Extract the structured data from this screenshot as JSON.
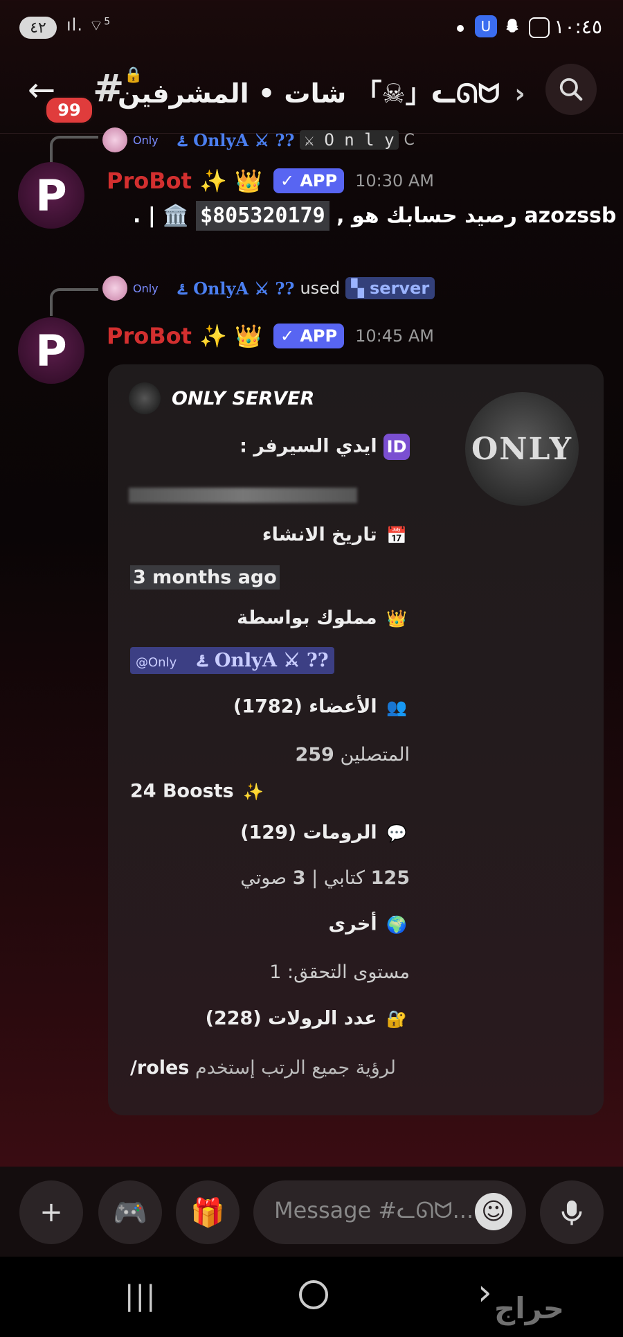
{
  "status_bar": {
    "battery": "٤٢",
    "signal": "ıl.",
    "wifi_label": "5",
    "clock": "١٠:٤٥"
  },
  "header": {
    "unread_badge": "99",
    "channel_name": "شات • المشرفين 「☠」ᓚᘏᗢ",
    "chevron": "›"
  },
  "messages": [
    {
      "reply_tag": "Only",
      "reply_user": "ۓ OnlyA ⚔ ??",
      "reply_extra": "⚔ O n l y",
      "reply_trailing": "C",
      "bot_name": "ProBot ✨ 👑",
      "app_badge": "✓ APP",
      "time": "10:30 AM",
      "body_name": "azozssb ـ",
      "body_text": ", رصيد حسابك هو",
      "body_amount": "$805320179",
      "body_tail": ". | 🏛️"
    },
    {
      "reply_tag": "Only",
      "reply_user": "ۓ OnlyA ⚔ ??",
      "reply_used": "used",
      "reply_command": "server",
      "bot_name": "ProBot ✨ 👑",
      "app_badge": "✓ APP",
      "time": "10:45 AM"
    }
  ],
  "embed": {
    "title": "ONLY SERVER",
    "thumbnail_text": "ONLY",
    "server_id_label": ": ايدي السيرفر",
    "server_id_icon": "ID",
    "created_label": "تاريخ الانشاء",
    "created_icon": "📅",
    "created_value": "3 months ago",
    "owner_label": "مملوك بواسطة",
    "owner_icon": "👑",
    "owner_mention_tag": "@Only",
    "owner_mention_name": "ۓ OnlyA ⚔ ??",
    "members_label": "الأعضاء (1782)",
    "members_icon": "👥",
    "online_label": "المتصلين",
    "online_value": "259",
    "boosts": "24 Boosts",
    "boosts_icon": "✨",
    "rooms_label": "الرومات (129)",
    "rooms_icon": "💬",
    "rooms_text_count": "125",
    "rooms_text_label": "كتابي |",
    "rooms_voice_count": "3",
    "rooms_voice_label": "صوتي",
    "other_label": "أخرى",
    "other_icon": "🌍",
    "verification": "مستوى التحقق: 1",
    "roles_label": "عدد الرولات (228)",
    "roles_icon": "🔐",
    "roles_hint_prefix": "لرؤية جميع الرتب إستخدم",
    "roles_hint_cmd": "roles/"
  },
  "composer": {
    "placeholder": "Message #ᓚᘏᗢ..."
  },
  "watermark": "حراج",
  "icons": [
    "battery-icon",
    "signal-icon",
    "wifi-icon",
    "shield-icon",
    "snapchat-icon",
    "screenshot-icon",
    "back-arrow-icon",
    "hashtag-lock-icon",
    "search-icon",
    "plus-icon",
    "gamepad-icon",
    "gift-icon",
    "emoji-icon",
    "microphone-icon",
    "recent-apps-icon",
    "home-icon",
    "back-nav-icon"
  ],
  "colors": {
    "accent": "#5865f2",
    "badge_red": "#e03c3c",
    "bot_red": "#d32f2f",
    "mention_bg": "#3c3f84"
  }
}
